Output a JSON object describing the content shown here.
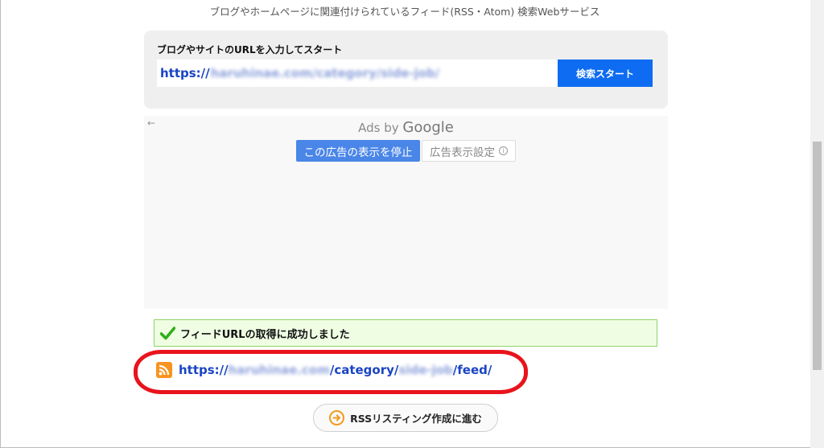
{
  "tagline": "ブログやホームページに関連付けられているフィード(RSS・Atom) 検索Webサービス",
  "search": {
    "title": "ブログやサイトのURLを入力してスタート",
    "url_prefix": "https://",
    "url_rest": "haruhinae.com/category/side-job/",
    "button_label": "検索スタート"
  },
  "ad": {
    "ads_by": "Ads by",
    "google": "Google",
    "stop_label": "この広告の表示を停止",
    "settings_label": "広告表示設定"
  },
  "result": {
    "success_message": "フィードURLの取得に成功しました",
    "feed_parts": [
      "https://",
      "haruhinae.com",
      "/category/",
      "side-job",
      "/feed/"
    ]
  },
  "rss_list_button": "RSSリスティング作成に進む",
  "colors": {
    "accent": "#0d6cf2",
    "link": "#1a44c4",
    "success_bg": "#effde3",
    "highlight": "#e8141c",
    "rss": "#f7931e"
  }
}
